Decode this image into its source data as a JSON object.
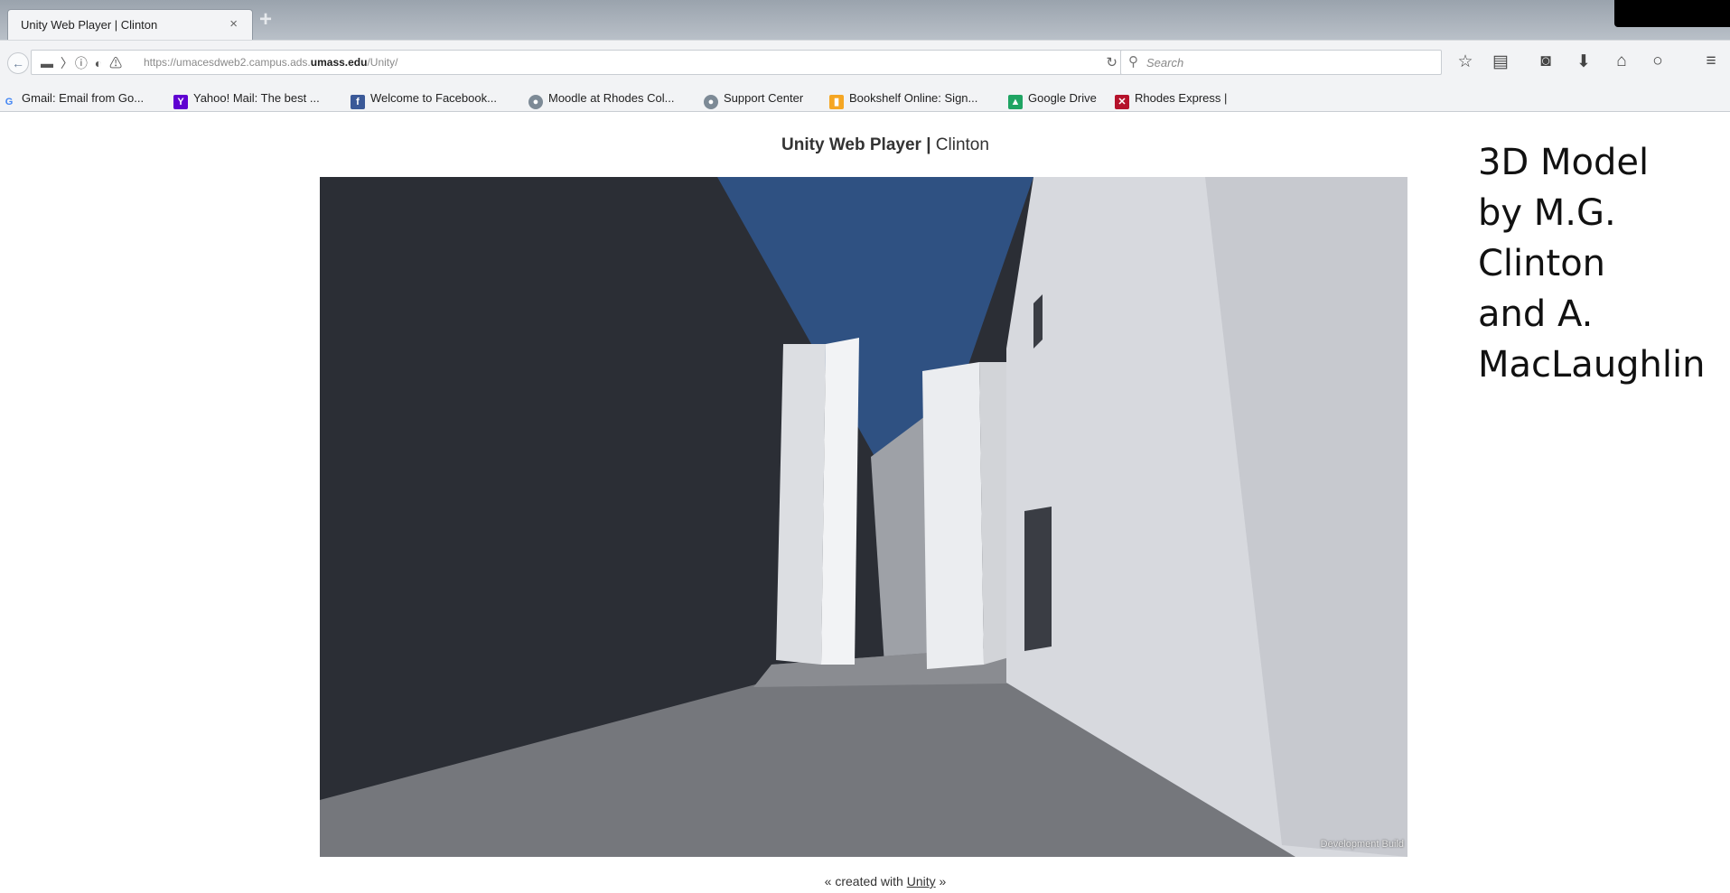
{
  "browser": {
    "tab": {
      "title": "Unity Web Player | Clinton",
      "close_icon": "×"
    },
    "new_tab_icon": "+",
    "url": {
      "prefix": "https://umacesdweb2.campus.ads.",
      "domain": "umass.edu",
      "path": "/Unity/"
    },
    "search_placeholder": "Search",
    "toolbar_icons": [
      "star-icon",
      "reading-list-icon",
      "pocket-icon",
      "download-icon",
      "home-icon",
      "chat-icon",
      "menu-icon"
    ],
    "bookmarks": [
      {
        "label": "Gmail: Email from Go...",
        "icon": "google-icon",
        "color": "#4285f4"
      },
      {
        "label": "Yahoo! Mail: The best ...",
        "icon": "yahoo-icon",
        "color": "#5f01d1"
      },
      {
        "label": "Welcome to Facebook...",
        "icon": "facebook-icon",
        "color": "#3b5998"
      },
      {
        "label": "Moodle at Rhodes Col...",
        "icon": "globe-icon",
        "color": "#7d8a96"
      },
      {
        "label": "Support Center",
        "icon": "globe-icon",
        "color": "#7d8a96"
      },
      {
        "label": "Bookshelf Online: Sign...",
        "icon": "bookshelf-icon",
        "color": "#f5a623"
      },
      {
        "label": "Google Drive",
        "icon": "drive-icon",
        "color": "#1fa463"
      },
      {
        "label": "Rhodes Express |",
        "icon": "rhodes-icon",
        "color": "#b5122b"
      }
    ]
  },
  "page": {
    "title_bold": "Unity Web Player",
    "title_sep": " | ",
    "title_name": "Clinton",
    "dev_build": "Development Build",
    "footer": {
      "prefix": "« created with ",
      "link": "Unity",
      "suffix": " »"
    },
    "credit_lines": [
      "3D Model",
      "by M.G.",
      "Clinton",
      "and A.",
      "MacLaughlin"
    ]
  },
  "colors": {
    "sky": "#2f5182",
    "dark_wall": "#2b2e35",
    "light_wall": "#d7d9de",
    "ground": "#75777c"
  }
}
